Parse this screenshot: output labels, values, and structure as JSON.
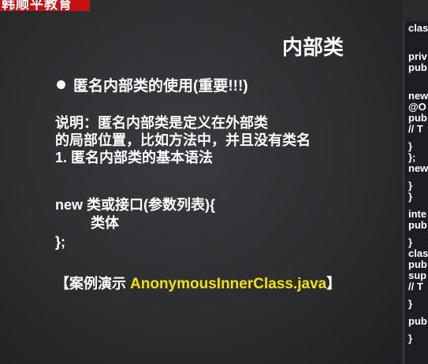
{
  "brand": {
    "text": "韩顺平教育"
  },
  "slide": {
    "title": "内部类",
    "bullet": "匿名内部类的使用(重要!!!)",
    "lines": [
      "说明：匿名内部类是定义在外部类",
      "的局部位置，比如方法中，并且没有类名",
      "1. 匿名内部类的基本语法"
    ],
    "syntax": [
      "new 类或接口(参数列表){",
      "         类体",
      "};"
    ],
    "demo_prefix": "【案例演示 ",
    "demo_file": "AnonymousInnerClass.java",
    "demo_suffix": "】"
  },
  "code_panel": {
    "lines": [
      "clas",
      "",
      "priv",
      "pub",
      "",
      "new",
      "@O",
      "pub",
      "// T",
      "}",
      "};",
      "new",
      "}",
      "}",
      "inte",
      "pub",
      "}",
      "clas",
      "pub",
      "sup",
      "// T",
      "}",
      "pub",
      "}"
    ]
  },
  "colors": {
    "brand_red": "#c51313",
    "highlight_yellow": "#f5e100",
    "slide_bg": "#2f3032"
  }
}
